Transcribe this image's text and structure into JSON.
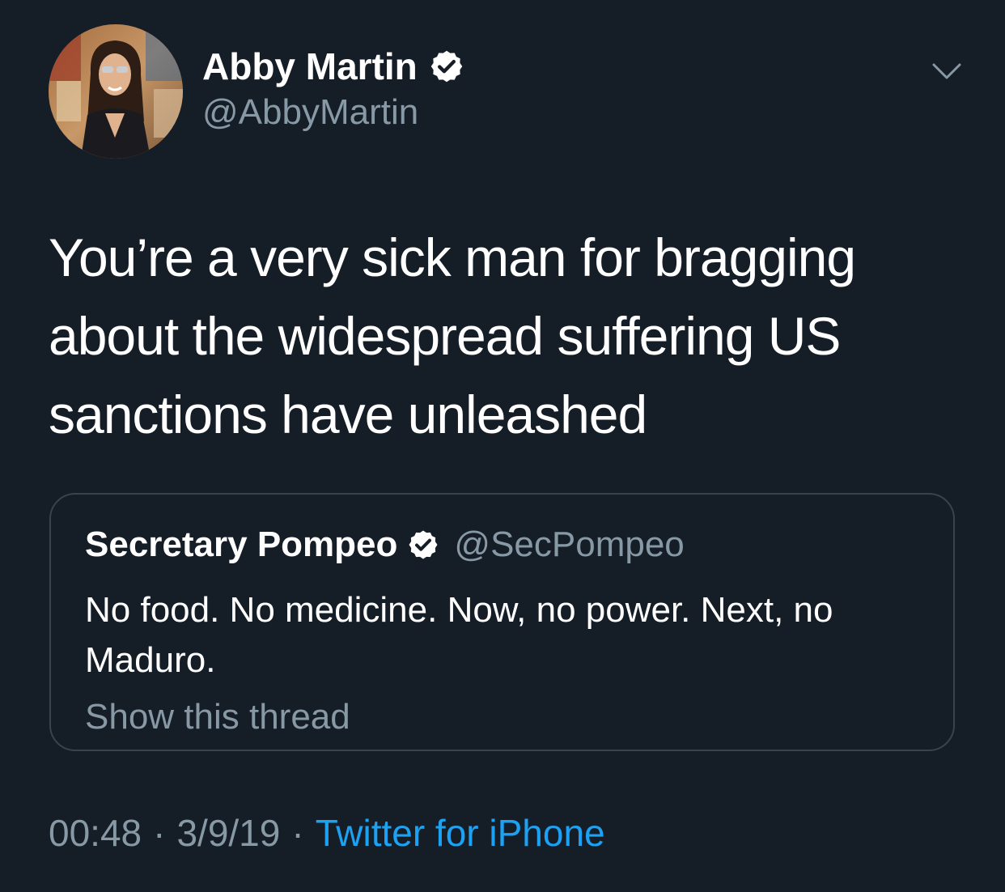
{
  "author": {
    "display_name": "Abby Martin",
    "handle": "@AbbyMartin",
    "verified_icon": "verified-badge-icon"
  },
  "tweet": {
    "text": "You’re a very sick man for bragging about the widespread suffering US sanctions have unleashed"
  },
  "quoted_tweet": {
    "display_name": "Secretary Pompeo",
    "handle": "@SecPompeo",
    "text": "No food. No medicine. Now, no power. Next, no Maduro.",
    "show_thread_label": "Show this thread"
  },
  "meta": {
    "time": "00:48",
    "separator": "·",
    "date": "3/9/19",
    "source": "Twitter for iPhone"
  },
  "colors": {
    "background": "#151d27",
    "secondary_text": "#8899a6",
    "link": "#1da1f2",
    "border": "#38444d"
  },
  "icons": {
    "menu": "chevron-down-icon",
    "verified": "verified-badge-icon"
  }
}
